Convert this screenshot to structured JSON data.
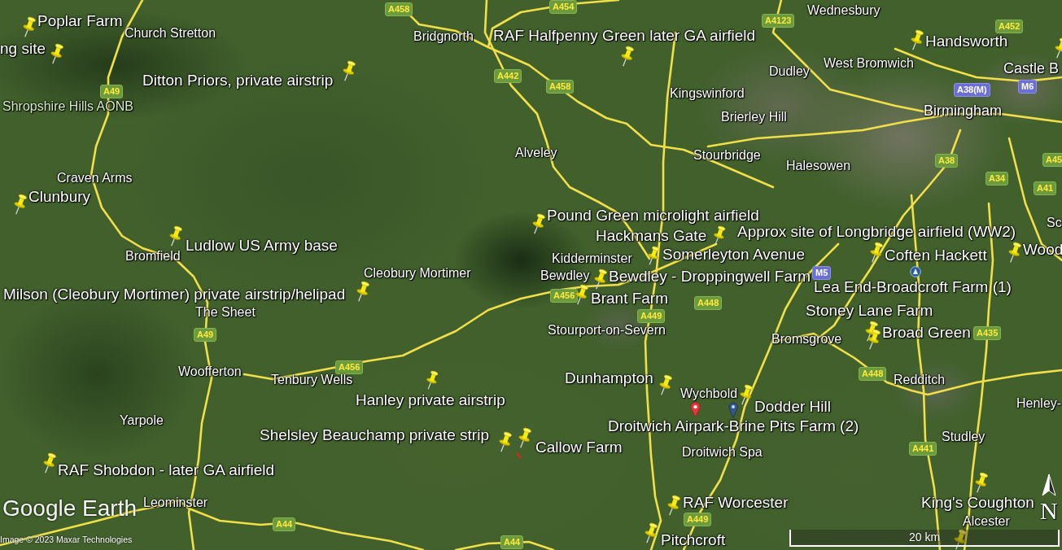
{
  "map": {
    "placemark_labels": [
      "Poplar Farm",
      "RAF Halfpenny Green later GA airfield",
      "ng site",
      "Handsworth",
      "Ditton Priors, private airstrip",
      "Clunbury",
      "Pound Green microlight airfield",
      "Hackmans Gate",
      "Approx site of Longbridge airfield (WW2)",
      "Ludlow US Army base",
      "Somerleyton Avenue",
      "Coften Hackett",
      "Wood",
      "Bewdley - Droppingwell Farm",
      "Milson (Cleobury Mortimer) private airstrip/helipad",
      "Brant Farm",
      "Lea End-Broadcroft Farm (1)",
      "Stoney Lane Farm",
      "Broad Green",
      "Dunhampton",
      "Hanley private airstrip",
      "Dodder Hill",
      "Shelsley Beauchamp private strip",
      "Droitwich Airpark-Brine Pits Farm (2)",
      "Callow Farm",
      "RAF Shobdon - later GA airfield",
      "RAF Worcester",
      "King's Coughton",
      "Pitchcroft"
    ],
    "markers": [
      {
        "kind": "pushpin"
      },
      {
        "kind": "pushpin"
      },
      {
        "kind": "pushpin"
      },
      {
        "kind": "pushpin"
      },
      {
        "kind": "pushpin"
      },
      {
        "kind": "pushpin"
      },
      {
        "kind": "pushpin"
      },
      {
        "kind": "pushpin"
      },
      {
        "kind": "pushpin"
      },
      {
        "kind": "pushpin"
      },
      {
        "kind": "pushpin"
      },
      {
        "kind": "pushpin"
      },
      {
        "kind": "pushpin"
      },
      {
        "kind": "pushpin"
      },
      {
        "kind": "circle_marker"
      },
      {
        "kind": "pushpin"
      },
      {
        "kind": "pushpin"
      },
      {
        "kind": "pushpin"
      },
      {
        "kind": "pushpin"
      },
      {
        "kind": "pushpin"
      },
      {
        "kind": "pushpin"
      },
      {
        "kind": "pushpin"
      },
      {
        "kind": "red_placemark"
      },
      {
        "kind": "blue_placemark"
      },
      {
        "kind": "pushpin"
      },
      {
        "kind": "pushpin"
      },
      {
        "kind": "pushpin"
      },
      {
        "kind": "red_mark"
      },
      {
        "kind": "pushpin"
      },
      {
        "kind": "pushpin"
      },
      {
        "kind": "pushpin"
      },
      {
        "kind": "pushpin"
      }
    ],
    "place_names": [
      {
        "text": "Wednesbury",
        "kind": "town"
      },
      {
        "text": "Church Stretton",
        "kind": "town"
      },
      {
        "text": "Bridgnorth",
        "kind": "town"
      },
      {
        "text": "Dudley",
        "kind": "town"
      },
      {
        "text": "West Bromwich",
        "kind": "town"
      },
      {
        "text": "Castle B",
        "kind": "city"
      },
      {
        "text": "Kingswinford",
        "kind": "town"
      },
      {
        "text": "Shropshire Hills AONB",
        "kind": "area"
      },
      {
        "text": "Brierley Hill",
        "kind": "town"
      },
      {
        "text": "Birmingham",
        "kind": "city"
      },
      {
        "text": "Alveley",
        "kind": "town"
      },
      {
        "text": "Stourbridge",
        "kind": "town"
      },
      {
        "text": "Halesowen",
        "kind": "town"
      },
      {
        "text": "Craven Arms",
        "kind": "town"
      },
      {
        "text": "Sc",
        "kind": "town"
      },
      {
        "text": "Bromfield",
        "kind": "town"
      },
      {
        "text": "Kidderminster",
        "kind": "town"
      },
      {
        "text": "Cleobury Mortimer",
        "kind": "town"
      },
      {
        "text": "Bewdley",
        "kind": "town"
      },
      {
        "text": "The Sheet",
        "kind": "town"
      },
      {
        "text": "Stourport-on-Severn",
        "kind": "town"
      },
      {
        "text": "Bromsgrove",
        "kind": "town"
      },
      {
        "text": "Woofferton",
        "kind": "town"
      },
      {
        "text": "Tenbury Wells",
        "kind": "town"
      },
      {
        "text": "Redditch",
        "kind": "town"
      },
      {
        "text": "Wychbold",
        "kind": "town"
      },
      {
        "text": "Henley-",
        "kind": "town"
      },
      {
        "text": "Yarpole",
        "kind": "town"
      },
      {
        "text": "Studley",
        "kind": "town"
      },
      {
        "text": "Droitwich Spa",
        "kind": "town"
      },
      {
        "text": "Leominster",
        "kind": "town"
      },
      {
        "text": "Alcester",
        "kind": "town"
      }
    ],
    "road_badges": [
      {
        "text": "A458",
        "kind": "a_road"
      },
      {
        "text": "A454",
        "kind": "a_road"
      },
      {
        "text": "A4123",
        "kind": "a_road"
      },
      {
        "text": "A452",
        "kind": "a_road"
      },
      {
        "text": "A442",
        "kind": "a_road"
      },
      {
        "text": "A49",
        "kind": "a_road"
      },
      {
        "text": "A458",
        "kind": "a_road"
      },
      {
        "text": "A38(M)",
        "kind": "motorway"
      },
      {
        "text": "M6",
        "kind": "motorway"
      },
      {
        "text": "A38",
        "kind": "a_road"
      },
      {
        "text": "A45",
        "kind": "a_road"
      },
      {
        "text": "A34",
        "kind": "a_road"
      },
      {
        "text": "A41",
        "kind": "a_road"
      },
      {
        "text": "M5",
        "kind": "motorway"
      },
      {
        "text": "A456",
        "kind": "a_road"
      },
      {
        "text": "A448",
        "kind": "a_road"
      },
      {
        "text": "A449",
        "kind": "a_road"
      },
      {
        "text": "A49",
        "kind": "a_road"
      },
      {
        "text": "A435",
        "kind": "a_road"
      },
      {
        "text": "A456",
        "kind": "a_road"
      },
      {
        "text": "A448",
        "kind": "a_road"
      },
      {
        "text": "A441",
        "kind": "a_road"
      },
      {
        "text": "A44",
        "kind": "a_road"
      },
      {
        "text": "A449",
        "kind": "a_road"
      },
      {
        "text": "A44",
        "kind": "a_road"
      }
    ]
  },
  "overlays": {
    "compass": {
      "label": "N"
    },
    "scale_bar": {
      "label": "20 km"
    },
    "logo": "Google Earth",
    "attribution": "Image © 2023 Maxar Technologies"
  }
}
